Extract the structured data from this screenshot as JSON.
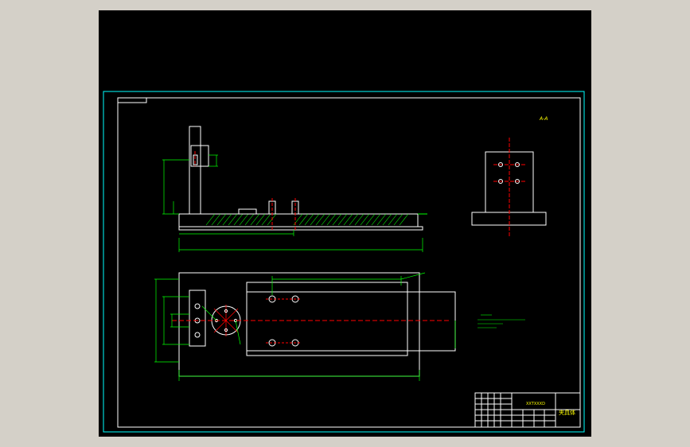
{
  "colors": {
    "background": "#d4d0c8",
    "viewport": "#000000",
    "sheet_border": "#00ffff",
    "geometry": "#ffffff",
    "dimensions": "#00ff00",
    "centerlines": "#ff0000",
    "hatch": "#00ff00",
    "title_text": "#ffff00"
  },
  "drawing": {
    "view_label": "A-A",
    "title_block": {
      "part_name": "夹具体",
      "school": "XXTXXXD"
    }
  }
}
